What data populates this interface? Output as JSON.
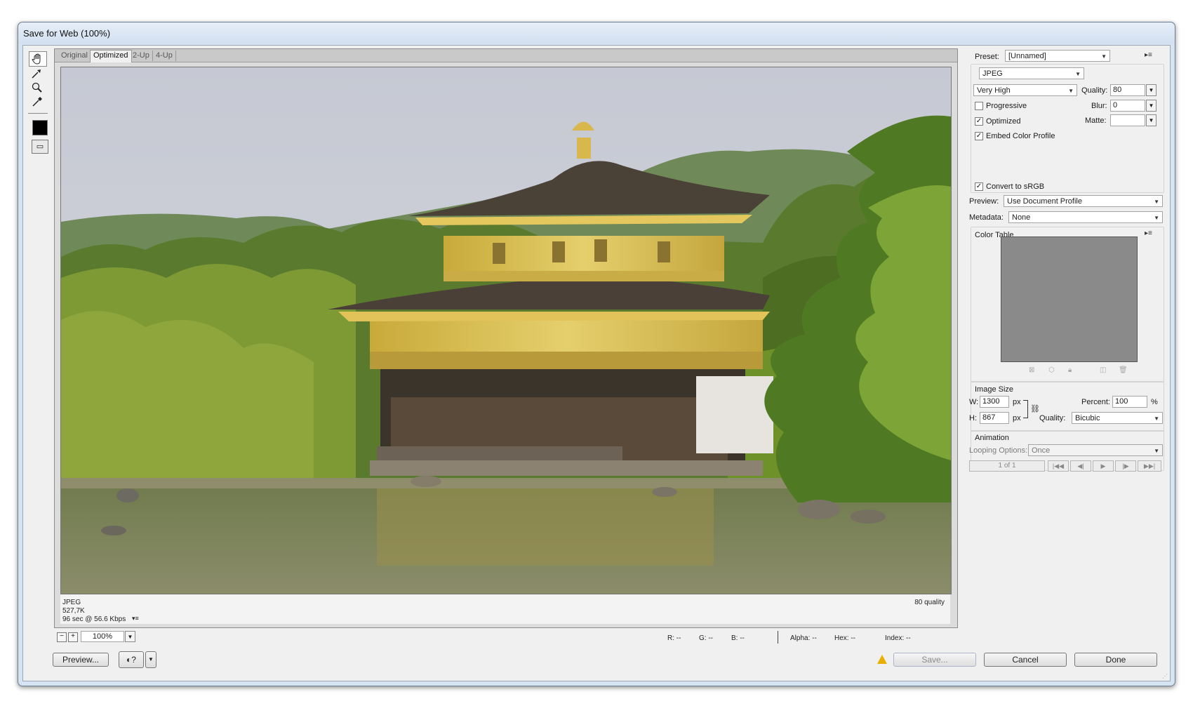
{
  "window": {
    "title": "Save for Web (100%)"
  },
  "tools": [
    "hand-tool",
    "slice-select-tool",
    "zoom-tool",
    "eyedropper-tool"
  ],
  "tabs": [
    {
      "label": "Original"
    },
    {
      "label": "Optimized"
    },
    {
      "label": "2-Up"
    },
    {
      "label": "4-Up"
    }
  ],
  "image_info": {
    "format": "JPEG",
    "size": "527,7K",
    "time": "96 sec @ 56.6 Kbps",
    "quality": "80 quality"
  },
  "settings": {
    "preset_label": "Preset:",
    "preset_value": "[Unnamed]",
    "format_value": "JPEG",
    "quality_level": "Very High",
    "quality_label": "Quality:",
    "quality_value": "80",
    "progressive_label": "Progressive",
    "blur_label": "Blur:",
    "blur_value": "0",
    "optimized_label": "Optimized",
    "matte_label": "Matte:",
    "embed_label": "Embed Color Profile",
    "srgb_label": "Convert to sRGB",
    "preview_label": "Preview:",
    "preview_value": "Use Document Profile",
    "metadata_label": "Metadata:",
    "metadata_value": "None"
  },
  "color_table": {
    "label": "Color Table"
  },
  "image_size": {
    "label": "Image Size",
    "w_label": "W:",
    "w_value": "1300",
    "h_label": "H:",
    "h_value": "867",
    "unit": "px",
    "percent_label": "Percent:",
    "percent_value": "100",
    "percent_unit": "%",
    "quality_label": "Quality:",
    "quality_value": "Bicubic"
  },
  "animation": {
    "label": "Animation",
    "looping_label": "Looping Options:",
    "looping_value": "Once",
    "frame": "1 of 1"
  },
  "statusbar": {
    "zoom": "100%",
    "r": "R: --",
    "g": "G: --",
    "b": "B: --",
    "alpha": "Alpha: --",
    "hex": "Hex: --",
    "index": "Index: --"
  },
  "buttons": {
    "preview": "Preview...",
    "save": "Save...",
    "cancel": "Cancel",
    "done": "Done"
  },
  "colors": {
    "accent": "#d5e3f2",
    "warning": "#e8b000"
  }
}
